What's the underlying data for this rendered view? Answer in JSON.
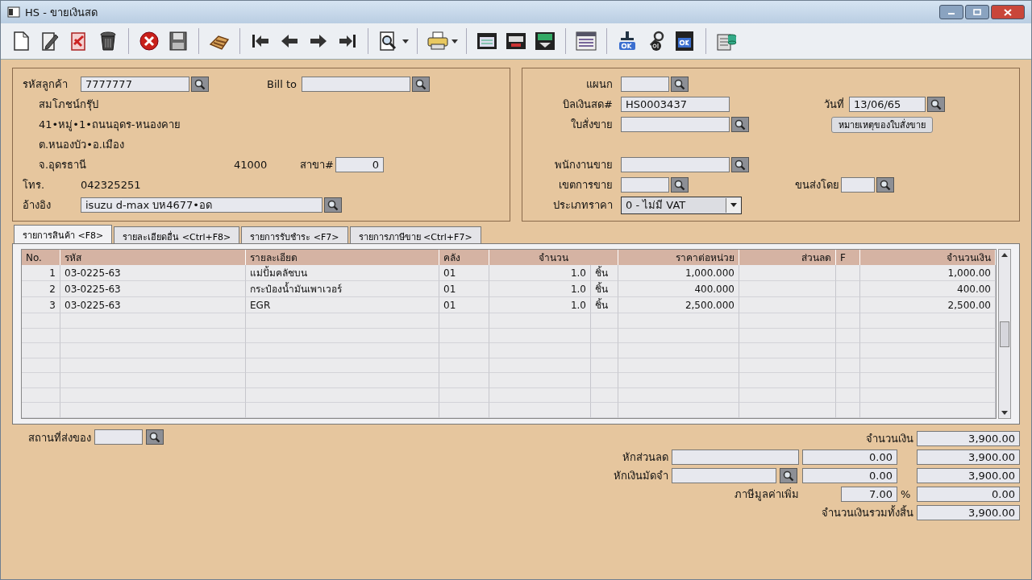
{
  "window": {
    "title": "HS - ขายเงินสด"
  },
  "customer": {
    "code_label": "รหัสลูกค้า",
    "code": "7777777",
    "bill_to_label": "Bill to",
    "name": "สมโภชน์กรุ๊ป",
    "address": [
      "41•หมู่•1•ถนนอุดร-หนองคาย",
      "ต.หนองบัว•อ.เมือง"
    ],
    "province": "จ.อุดรธานี",
    "postcode": "41000",
    "branch_label": "สาขา#",
    "branch": "0",
    "phone_label": "โทร.",
    "phone": "042325251",
    "reference_label": "อ้างอิง",
    "reference": "isuzu d-max บห4677•อด"
  },
  "document": {
    "department_label": "แผนก",
    "bill_label": "บิลเงินสด#",
    "bill_no": "HS0003437",
    "date_label": "วันที่",
    "date": "13/06/65",
    "order_label": "ใบสั่งขาย",
    "order_note_button": "หมายเหตุของใบสั่งขาย",
    "salesperson_label": "พนักงานขาย",
    "area_label": "เขตการขาย",
    "shipping_label": "ขนส่งโดย",
    "price_type_label": "ประเภทราคา",
    "price_type": "0 - ไม่มี VAT"
  },
  "tabs": [
    {
      "label": "รายการสินค้า <F8>",
      "selected": true
    },
    {
      "label": "รายละเอียดอื่น <Ctrl+F8>",
      "selected": false
    },
    {
      "label": "รายการรับชำระ <F7>",
      "selected": false
    },
    {
      "label": "รายการภาษีขาย <Ctrl+F7>",
      "selected": false
    }
  ],
  "table": {
    "columns": [
      "No.",
      "รหัส",
      "รายละเอียด",
      "คลัง",
      "จำนวน",
      "ราคาต่อหน่วย",
      "ส่วนลด",
      "F",
      "จำนวนเงิน"
    ],
    "rows": [
      {
        "no": "1",
        "code": "03-0225-63",
        "description": "แม่ปั้มคลัชบน",
        "warehouse": "01",
        "quantity": "1.0",
        "unit": "ชิ้น",
        "unit_price": "1,000.000",
        "amount": "1,000.00"
      },
      {
        "no": "2",
        "code": "03-0225-63",
        "description": "กระป๋องน้ำมันเพาเวอร์",
        "warehouse": "01",
        "quantity": "1.0",
        "unit": "ชิ้น",
        "unit_price": "400.000",
        "amount": "400.00"
      },
      {
        "no": "3",
        "code": "03-0225-63",
        "description": "EGR",
        "warehouse": "01",
        "quantity": "1.0",
        "unit": "ชิ้น",
        "unit_price": "2,500.000",
        "amount": "2,500.00"
      }
    ]
  },
  "delivery": {
    "label": "สถานที่ส่งของ"
  },
  "totals": {
    "amount_label": "จำนวนเงิน",
    "amount": "3,900.00",
    "discount_label": "หักส่วนลด",
    "discount": "0.00",
    "after_discount": "3,900.00",
    "deposit_label": "หักเงินมัดจำ",
    "deposit": "0.00",
    "after_deposit": "3,900.00",
    "vat_label": "ภาษีมูลค่าเพิ่ม",
    "vat_rate": "7.00",
    "percent": "%",
    "vat": "0.00",
    "total_label": "จำนวนเงินรวมทั้งสิ้น",
    "total": "3,900.00"
  }
}
